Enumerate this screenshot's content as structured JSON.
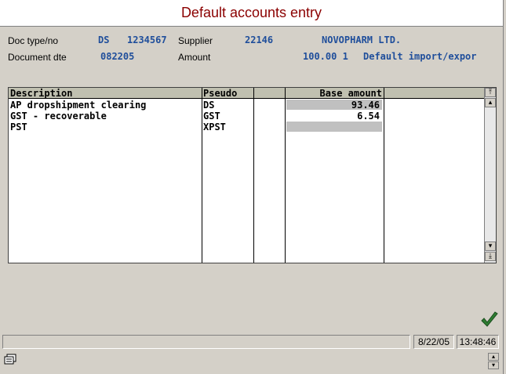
{
  "window": {
    "title": "Default accounts entry"
  },
  "header": {
    "doc_type_label": "Doc type/no",
    "doc_type": "DS",
    "doc_no": "1234567",
    "supplier_label": "Supplier",
    "supplier_code": "22146",
    "supplier_name": "NOVOPHARM LTD.",
    "doc_date_label": "Document dte",
    "doc_date": "082205",
    "amount_label": "Amount",
    "amount_value": "100.00 1",
    "amount_desc": "Default import/expor"
  },
  "table": {
    "columns": [
      "Description",
      "Pseudo",
      "",
      "Base amount",
      ""
    ],
    "rows": [
      {
        "description": "AP dropshipment clearing",
        "pseudo": "DS",
        "extra": "",
        "base_amount": "93.46"
      },
      {
        "description": "GST - recoverable",
        "pseudo": "GST",
        "extra": "",
        "base_amount": "6.54"
      },
      {
        "description": "PST",
        "pseudo": "XPST",
        "extra": "",
        "base_amount": ""
      }
    ]
  },
  "status": {
    "date": "8/22/05",
    "time": "13:48:46"
  },
  "icons": {
    "accept": "checkmark-icon",
    "window": "window-switch-icon"
  }
}
